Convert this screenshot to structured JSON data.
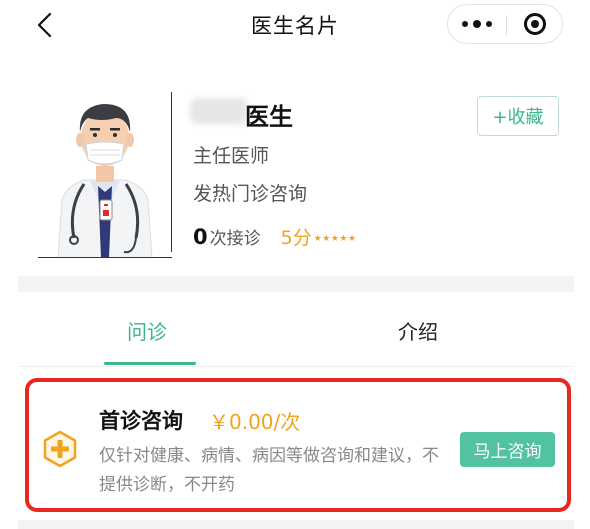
{
  "nav": {
    "title": "医生名片"
  },
  "doctor": {
    "name_suffix": "医生",
    "title": "主任医师",
    "department": "发热门诊咨询",
    "consult_count": "0",
    "consult_count_label": "次接诊",
    "score": "5分",
    "stars": "★★★★★",
    "favorite_label": "+收藏"
  },
  "tabs": [
    {
      "label": "问诊",
      "active": true
    },
    {
      "label": "介绍",
      "active": false
    }
  ],
  "service": {
    "title": "首诊咨询",
    "price": "￥0.00/次",
    "description": "仅针对健康、病情、病因等做咨询和建议，不提供诊断，不开药",
    "button_label": "马上咨询"
  },
  "colors": {
    "accent": "#3cb58f",
    "price": "#f0a41e",
    "highlight_border": "#e8271e"
  }
}
